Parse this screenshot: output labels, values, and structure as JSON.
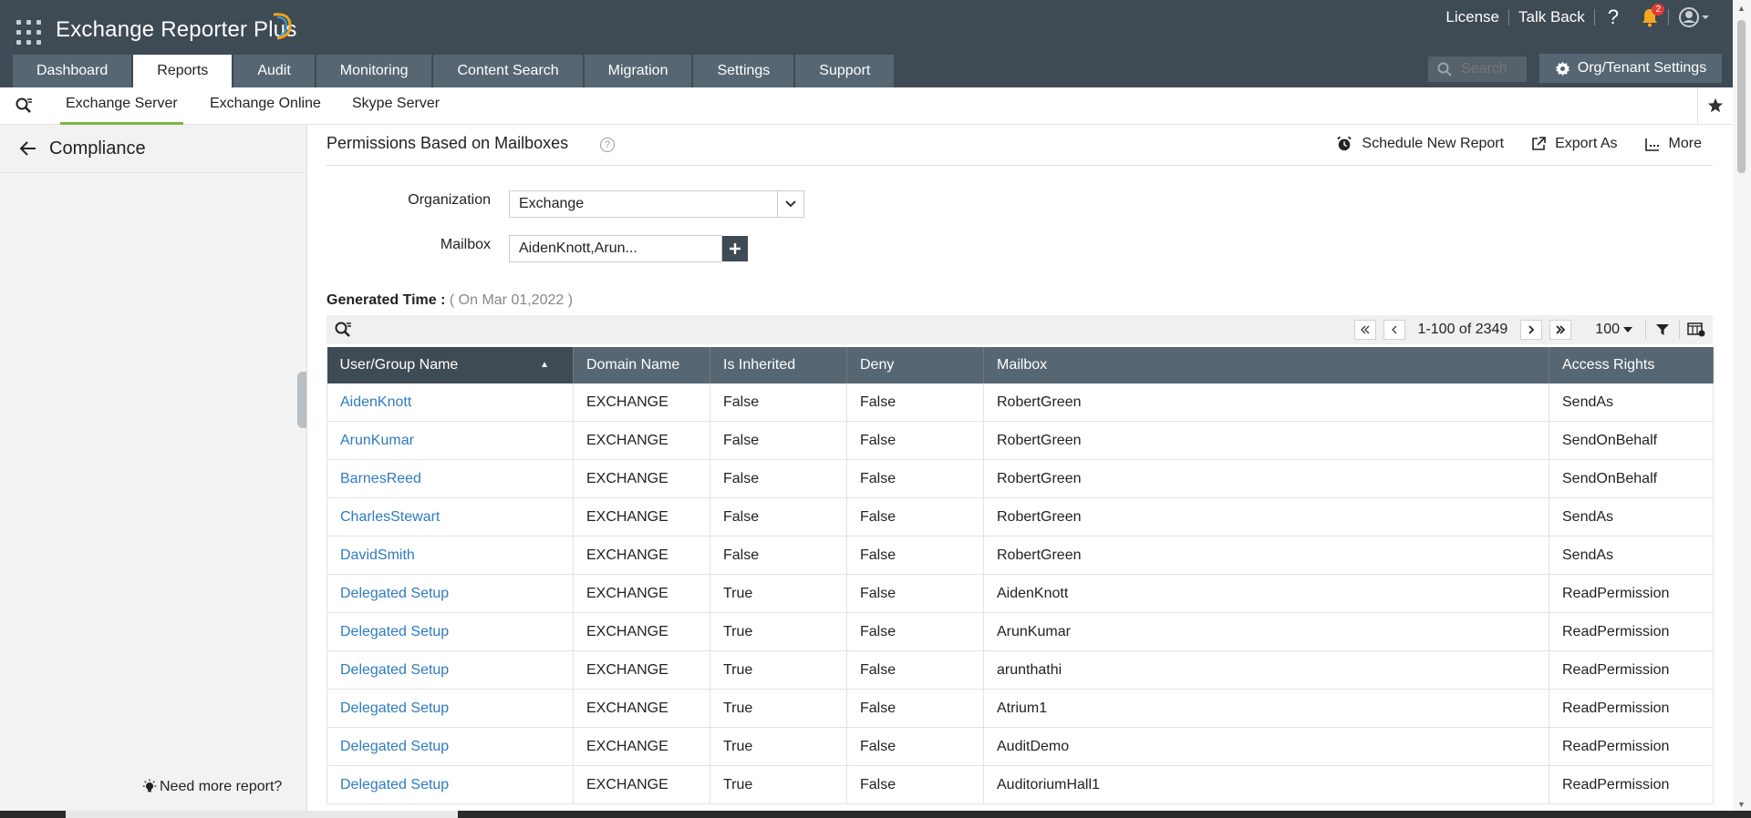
{
  "app": {
    "title": "Exchange Reporter Plus"
  },
  "top_links": {
    "license": "License",
    "talk_back": "Talk Back",
    "help": "?",
    "notif_count": "2"
  },
  "tabs": [
    {
      "label": "Dashboard"
    },
    {
      "label": "Reports"
    },
    {
      "label": "Audit"
    },
    {
      "label": "Monitoring"
    },
    {
      "label": "Content Search"
    },
    {
      "label": "Migration"
    },
    {
      "label": "Settings"
    },
    {
      "label": "Support"
    }
  ],
  "active_tab": "Reports",
  "search": {
    "placeholder": "Search"
  },
  "org_settings": {
    "label": "Org/Tenant Settings"
  },
  "subtabs": [
    {
      "label": "Exchange Server"
    },
    {
      "label": "Exchange Online"
    },
    {
      "label": "Skype Server"
    }
  ],
  "sidebar": {
    "section": "Compliance",
    "need_more": "Need more report?"
  },
  "report": {
    "title": "Permissions Based on Mailboxes",
    "actions": {
      "schedule": "Schedule New Report",
      "export": "Export As",
      "more": "More"
    },
    "filters": {
      "organization_label": "Organization",
      "organization_value": "Exchange",
      "mailbox_label": "Mailbox",
      "mailbox_value": "AidenKnott,Arun..."
    },
    "generated_label": "Generated Time :",
    "generated_value": "( On Mar 01,2022 )",
    "pager": {
      "range": "1-100 of 2349",
      "page_size": "100"
    },
    "columns": [
      "User/Group Name",
      "Domain Name",
      "Is Inherited",
      "Deny",
      "Mailbox",
      "Access Rights"
    ],
    "rows": [
      [
        "AidenKnott",
        "EXCHANGE",
        "False",
        "False",
        "RobertGreen",
        "SendAs"
      ],
      [
        "ArunKumar",
        "EXCHANGE",
        "False",
        "False",
        "RobertGreen",
        "SendOnBehalf"
      ],
      [
        "BarnesReed",
        "EXCHANGE",
        "False",
        "False",
        "RobertGreen",
        "SendOnBehalf"
      ],
      [
        "CharlesStewart",
        "EXCHANGE",
        "False",
        "False",
        "RobertGreen",
        "SendAs"
      ],
      [
        "DavidSmith",
        "EXCHANGE",
        "False",
        "False",
        "RobertGreen",
        "SendAs"
      ],
      [
        "Delegated Setup",
        "EXCHANGE",
        "True",
        "False",
        "AidenKnott",
        "ReadPermission"
      ],
      [
        "Delegated Setup",
        "EXCHANGE",
        "True",
        "False",
        "ArunKumar",
        "ReadPermission"
      ],
      [
        "Delegated Setup",
        "EXCHANGE",
        "True",
        "False",
        "arunthathi",
        "ReadPermission"
      ],
      [
        "Delegated Setup",
        "EXCHANGE",
        "True",
        "False",
        "Atrium1",
        "ReadPermission"
      ],
      [
        "Delegated Setup",
        "EXCHANGE",
        "True",
        "False",
        "AuditDemo",
        "ReadPermission"
      ],
      [
        "Delegated Setup",
        "EXCHANGE",
        "True",
        "False",
        "AuditoriumHall1",
        "ReadPermission"
      ]
    ]
  },
  "colors": {
    "header_bg": "#3e4a54",
    "tab_bg": "#566672",
    "link": "#2e7bc0",
    "accent_green": "#7ab648"
  }
}
